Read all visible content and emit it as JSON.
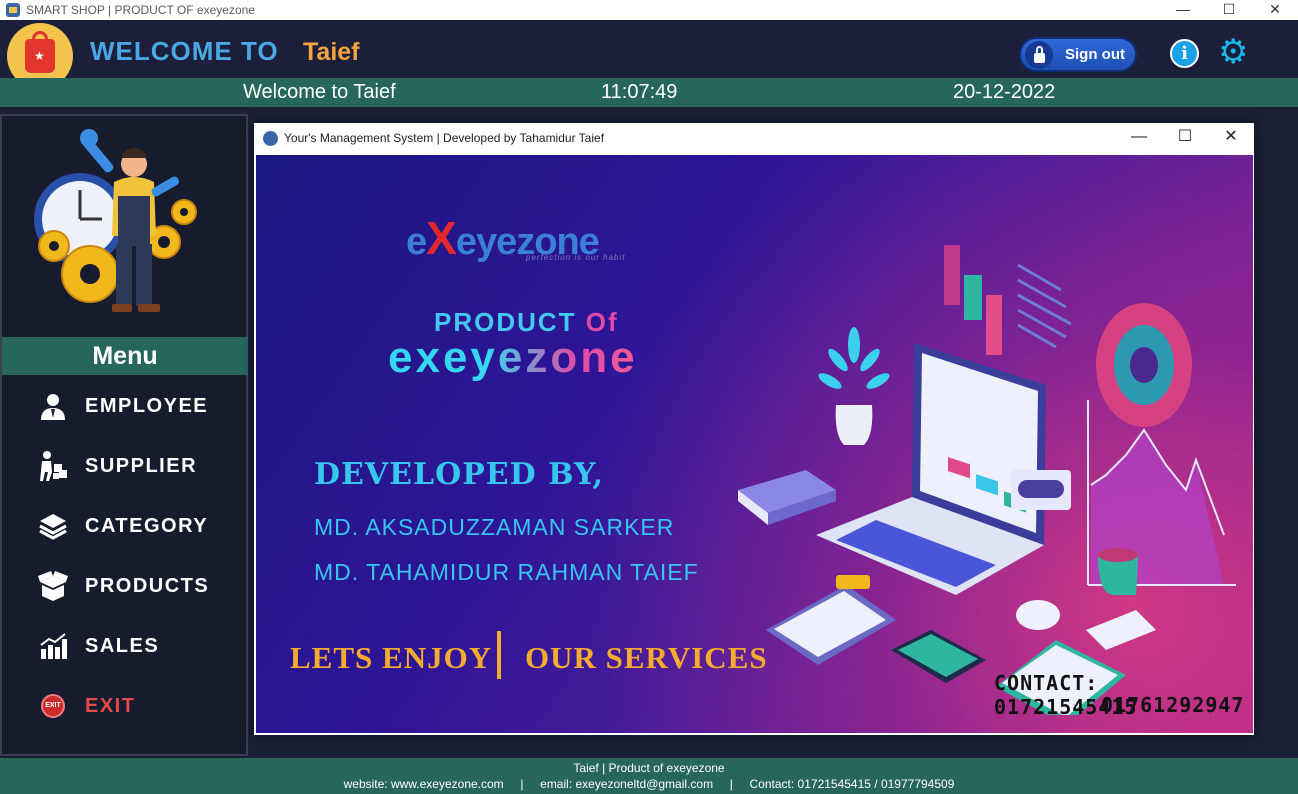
{
  "os_window": {
    "title": "SMART SHOP | PRODUCT OF exeyezone",
    "minimize": "—",
    "maximize": "☐",
    "close": "✕"
  },
  "header": {
    "welcome_label": "WELCOME TO",
    "username": "Taief",
    "signout_label": "Sign out",
    "info_icon": "i",
    "settings_icon": "⚙"
  },
  "statusbar": {
    "greeting": "Welcome to Taief",
    "time": "11:07:49",
    "date": "20-12-2022"
  },
  "sidebar": {
    "menu_title": "Menu",
    "items": [
      {
        "label": "EMPLOYEE",
        "icon": "employee-icon"
      },
      {
        "label": "SUPPLIER",
        "icon": "supplier-icon"
      },
      {
        "label": "CATEGORY",
        "icon": "category-icon"
      },
      {
        "label": "PRODUCTS",
        "icon": "products-icon"
      },
      {
        "label": "SALES",
        "icon": "sales-icon"
      },
      {
        "label": "EXIT",
        "icon": "exit-icon"
      }
    ],
    "exit_badge": "EXIT"
  },
  "inner_window": {
    "title": "Your's Management System | Developed by Tahamidur Taief",
    "minimize": "—",
    "maximize": "☐",
    "close": "✕"
  },
  "banner": {
    "brand_e": "e",
    "brand_x": "X",
    "brand_rest": "eyezone",
    "brand_tagline": "perfection is our habit",
    "product_of_1": "PRODUCT ",
    "product_of_2": "Of",
    "product_brand": "exeyezone",
    "developed_by": "DEVELOPED BY,",
    "developer_1": "MD. AKSADUZZAMAN SARKER",
    "developer_2": "MD. TAHAMIDUR RAHMAN TAIEF",
    "lets_enjoy": "LETS ENJOY",
    "our_services": "OUR SERVICES",
    "contact_1": "CONTACT: 01721545415",
    "contact_2": "01761292947"
  },
  "footer": {
    "line1": "Taief | Product of exeyezone",
    "line2": "website: www.exeyezone.com     |     email: exeyezoneltd@gmail.com     |     Contact: 01721545415 / 01977794509"
  },
  "colors": {
    "header_bg": "#1b1f3a",
    "accent_green": "#27665a",
    "welcome_blue": "#4aa8e6",
    "user_orange": "#f4a340",
    "exit_red": "#e54949",
    "banner_cyan": "#36c6ee",
    "banner_gold": "#f5ac2e"
  }
}
